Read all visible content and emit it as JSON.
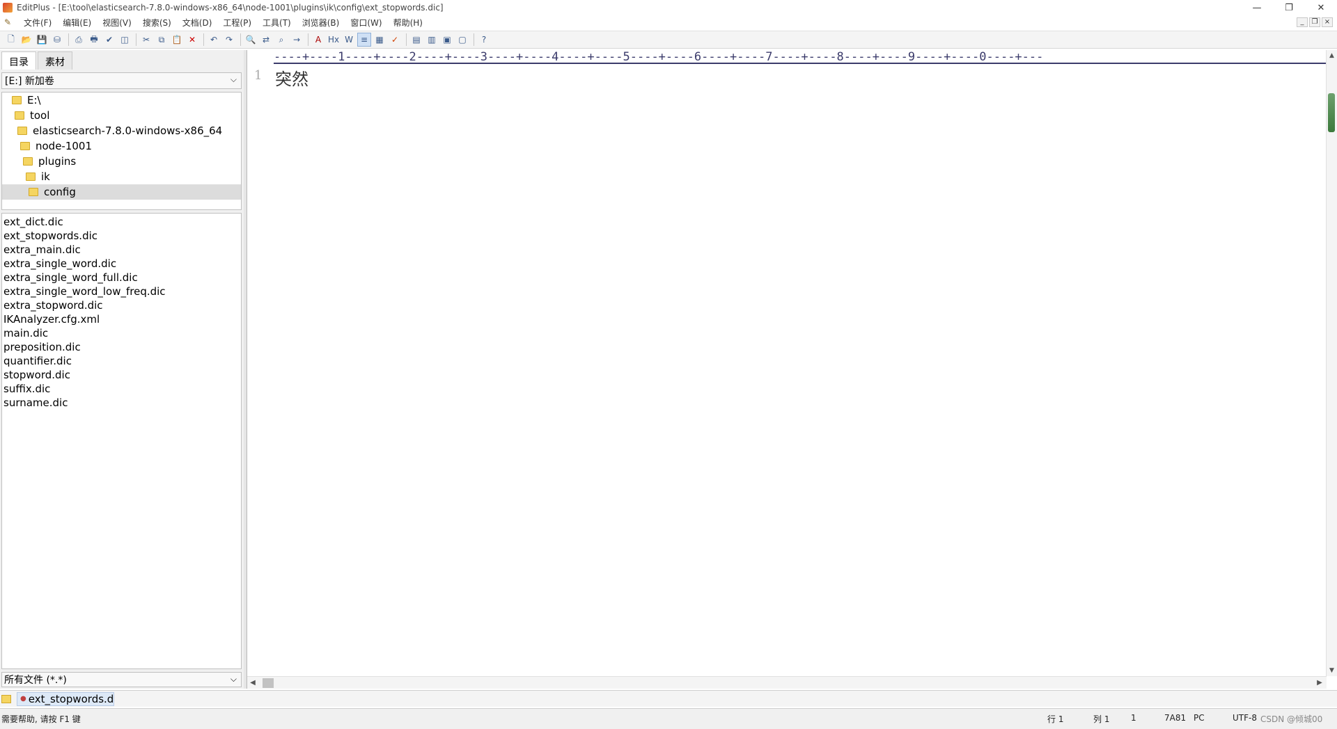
{
  "window": {
    "title": "EditPlus - [E:\\tool\\elasticsearch-7.8.0-windows-x86_64\\node-1001\\plugins\\ik\\config\\ext_stopwords.dic]",
    "controls": {
      "minimize": "—",
      "restore": "❐",
      "close": "✕"
    }
  },
  "menu": {
    "items": [
      "文件(F)",
      "编辑(E)",
      "视图(V)",
      "搜索(S)",
      "文档(D)",
      "工程(P)",
      "工具(T)",
      "浏览器(B)",
      "窗口(W)",
      "帮助(H)"
    ],
    "mdi": {
      "minimize": "_",
      "restore": "❐",
      "close": "×"
    }
  },
  "toolbar": {
    "icons": [
      "new-file-icon",
      "open-file-icon",
      "save-icon",
      "save-all-icon",
      "print-preview-icon",
      "print-icon",
      "spellcheck-icon",
      "browser-preview-icon",
      "cut-icon",
      "copy-icon",
      "paste-icon",
      "delete-icon",
      "undo-icon",
      "redo-icon",
      "find-icon",
      "replace-icon",
      "find-in-files-icon",
      "goto-line-icon",
      "font-icon",
      "hex-icon",
      "word-wrap-icon",
      "line-number-icon",
      "ruler-icon",
      "check-icon",
      "view-dir-icon",
      "view-clip-icon",
      "view-output-icon",
      "view-full-icon",
      "context-help-icon"
    ]
  },
  "left_panel": {
    "tabs": [
      "目录",
      "素材"
    ],
    "drive": "[E:] 新加卷",
    "tree": [
      {
        "label": "E:\\",
        "indent": 0
      },
      {
        "label": "tool",
        "indent": 1
      },
      {
        "label": "elasticsearch-7.8.0-windows-x86_64",
        "indent": 2
      },
      {
        "label": "node-1001",
        "indent": 3
      },
      {
        "label": "plugins",
        "indent": 4
      },
      {
        "label": "ik",
        "indent": 5
      },
      {
        "label": "config",
        "indent": 6,
        "selected": true
      }
    ],
    "files": [
      "ext_dict.dic",
      "ext_stopwords.dic",
      "extra_main.dic",
      "extra_single_word.dic",
      "extra_single_word_full.dic",
      "extra_single_word_low_freq.dic",
      "extra_stopword.dic",
      "IKAnalyzer.cfg.xml",
      "main.dic",
      "preposition.dic",
      "quantifier.dic",
      "stopword.dic",
      "suffix.dic",
      "surname.dic"
    ],
    "filter": "所有文件 (*.*)"
  },
  "editor": {
    "ruler": "----+----1----+----2----+----3----+----4----+----5----+----6----+----7----+----8----+----9----+----0----+---",
    "lines": [
      {
        "number": "1",
        "text": "突然"
      }
    ]
  },
  "doc_tabs": [
    {
      "label": "ext_stopwords.dic"
    }
  ],
  "status": {
    "help": "需要帮助, 请按 F1 键",
    "row": "行 1",
    "col": "列 1",
    "sel": "1",
    "code": "7A81",
    "lineend": "PC",
    "encoding": "UTF-8",
    "watermark": "CSDN @倾城00"
  }
}
